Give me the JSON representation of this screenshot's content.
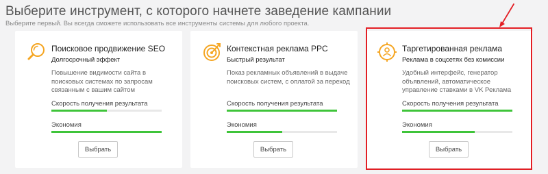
{
  "header": {
    "title": "Выберите инструмент, с которого начнете заведение кампании",
    "subtitle": "Выберите первый. Вы всегда сможете использовать все инструменты системы для любого проекта."
  },
  "colors": {
    "accent_orange": "#f5a623",
    "progress_green": "#3fc43a",
    "highlight_red": "#e31e24"
  },
  "cards": [
    {
      "icon": "magnifier-icon",
      "title": "Поисковое продвижение SEO",
      "tagline": "Долгосрочный эффект",
      "description": "Повышение видимости сайта в поисковых системах по запросам связанным с вашим сайтом",
      "speed_label": "Скорость получения результата",
      "speed_value": 0.5,
      "economy_label": "Экономия",
      "economy_value": 1.0,
      "button_label": "Выбрать"
    },
    {
      "icon": "target-icon",
      "title": "Контекстная реклама PPC",
      "tagline": "Быстрый результат",
      "description": "Показ рекламных объявлений в выдаче поисковых систем, с оплатой за переход",
      "speed_label": "Скорость получения результата",
      "speed_value": 1.0,
      "economy_label": "Экономия",
      "economy_value": 0.5,
      "button_label": "Выбрать"
    },
    {
      "icon": "audience-icon",
      "title": "Таргетированная реклама",
      "tagline": "Реклама в соцсетях без комиссии",
      "description": "Удобный интерфейс, генератор объявлений, автоматическое управление ставками в VK Реклама",
      "speed_label": "Скорость получения результата",
      "speed_value": 1.0,
      "economy_label": "Экономия",
      "economy_value": 0.66,
      "button_label": "Выбрать"
    }
  ]
}
